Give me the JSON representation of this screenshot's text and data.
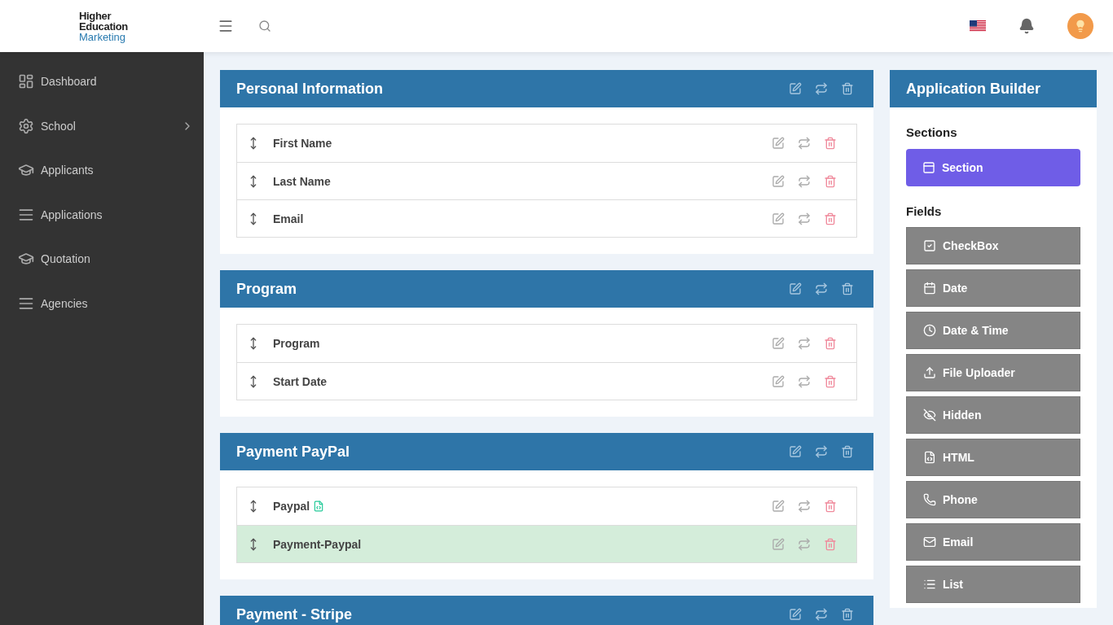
{
  "logo": {
    "line_1": "Higher",
    "line_2": "Education",
    "line_3": "Marketing"
  },
  "sidebar": {
    "items": [
      {
        "label": "Dashboard",
        "kind": "dashboard",
        "has_submenu": false
      },
      {
        "label": "School",
        "kind": "gear",
        "has_submenu": true
      },
      {
        "label": "Applicants",
        "kind": "cap",
        "has_submenu": false
      },
      {
        "label": "Applications",
        "kind": "lines",
        "has_submenu": false
      },
      {
        "label": "Quotation",
        "kind": "cap",
        "has_submenu": false
      },
      {
        "label": "Agencies",
        "kind": "lines",
        "has_submenu": false
      }
    ]
  },
  "sections": [
    {
      "title": "Personal Information",
      "fields": [
        {
          "label": "First Name",
          "highlighted": false,
          "html_badge": false
        },
        {
          "label": "Last Name",
          "highlighted": false,
          "html_badge": false
        },
        {
          "label": "Email",
          "highlighted": false,
          "html_badge": false
        }
      ]
    },
    {
      "title": "Program",
      "fields": [
        {
          "label": "Program",
          "highlighted": false,
          "html_badge": false
        },
        {
          "label": "Start Date",
          "highlighted": false,
          "html_badge": false
        }
      ]
    },
    {
      "title": "Payment PayPal",
      "fields": [
        {
          "label": "Paypal",
          "highlighted": false,
          "html_badge": true
        },
        {
          "label": "Payment-Paypal",
          "highlighted": true,
          "html_badge": false
        }
      ]
    },
    {
      "title": "Payment - Stripe"
    }
  ],
  "builder": {
    "title": "Application Builder",
    "sections_heading": "Sections",
    "section_buttons": [
      {
        "label": "Section",
        "kind": "section"
      }
    ],
    "fields_heading": "Fields",
    "field_buttons": [
      {
        "label": "CheckBox",
        "kind": "checkbox"
      },
      {
        "label": "Date",
        "kind": "date"
      },
      {
        "label": "Date & Time",
        "kind": "datetime"
      },
      {
        "label": "File Uploader",
        "kind": "upload"
      },
      {
        "label": "Hidden",
        "kind": "hidden"
      },
      {
        "label": "HTML",
        "kind": "html"
      },
      {
        "label": "Phone",
        "kind": "phone"
      },
      {
        "label": "Email",
        "kind": "email"
      },
      {
        "label": "List",
        "kind": "list"
      }
    ]
  }
}
